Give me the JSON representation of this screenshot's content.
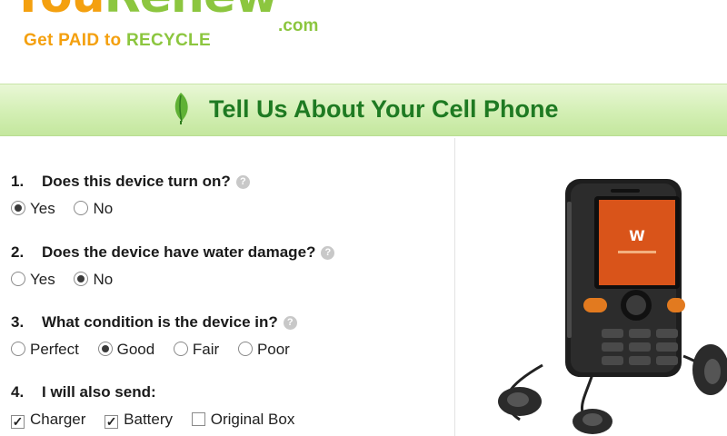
{
  "logo": {
    "wordmark_a": "You",
    "wordmark_b": "Renew",
    "domain": ".com",
    "tagline_a": "Get PAID to ",
    "tagline_b": "RECYCLE"
  },
  "page_title": "Tell Us About Your Cell Phone",
  "help_icon": "?",
  "questions": [
    {
      "number": "1.",
      "text": "Does this device turn on?",
      "options": [
        {
          "label": "Yes",
          "selected": true
        },
        {
          "label": "No",
          "selected": false
        }
      ]
    },
    {
      "number": "2.",
      "text": "Does the device have water damage?",
      "options": [
        {
          "label": "Yes",
          "selected": false
        },
        {
          "label": "No",
          "selected": true
        }
      ]
    },
    {
      "number": "3.",
      "text": "What condition is the device in?",
      "options": [
        {
          "label": "Perfect",
          "selected": false
        },
        {
          "label": "Good",
          "selected": true
        },
        {
          "label": "Fair",
          "selected": false
        },
        {
          "label": "Poor",
          "selected": false
        }
      ]
    },
    {
      "number": "4.",
      "text": "I will also send:",
      "options": [
        {
          "label": "Charger",
          "checked": true
        },
        {
          "label": "Battery",
          "checked": true
        },
        {
          "label": "Original Box",
          "checked": false
        }
      ]
    }
  ],
  "colors": {
    "brand_orange": "#f4a00f",
    "brand_green": "#8cc63f",
    "title_green": "#1e7a22"
  },
  "icons": {
    "leaf": "leaf-icon",
    "help": "help-icon"
  }
}
